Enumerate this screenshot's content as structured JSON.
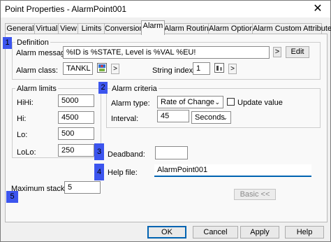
{
  "window": {
    "title": "Point Properties - AlarmPoint001",
    "close_glyph": "✕"
  },
  "tabs": [
    {
      "label": "General",
      "active": false
    },
    {
      "label": "Virtual",
      "active": false
    },
    {
      "label": "View",
      "active": false
    },
    {
      "label": "Limits",
      "active": false
    },
    {
      "label": "Conversion",
      "active": false
    },
    {
      "label": "Alarm",
      "active": true
    },
    {
      "label": "Alarm Routing",
      "active": false
    },
    {
      "label": "Alarm Options",
      "active": false
    },
    {
      "label": "Alarm Custom Attributes",
      "active": false
    }
  ],
  "definition": {
    "group_label": "Definition",
    "message_label": "Alarm message:",
    "message_value": "%ID is %STATE, Level is %VAL %EU!",
    "message_arrow": ">",
    "edit_label": "Edit",
    "class_label": "Alarm class:",
    "class_value": "TANKL",
    "class_arrow": ">",
    "string_index_label": "String index:",
    "string_index_value": "1",
    "string_index_arrow": ">"
  },
  "alarm_limits": {
    "group_label": "Alarm limits",
    "hihi_label": "HiHi:",
    "hihi_value": "5000",
    "hi_label": "Hi:",
    "hi_value": "4500",
    "lo_label": "Lo:",
    "lo_value": "500",
    "lolo_label": "LoLo:",
    "lolo_value": "250"
  },
  "alarm_criteria": {
    "group_label": "Alarm criteria",
    "type_label": "Alarm type:",
    "type_value": "Rate of Change",
    "update_value_label": "Update value",
    "update_value_checked": false,
    "interval_label": "Interval:",
    "interval_value": "45",
    "interval_unit": "Seconds"
  },
  "deadband": {
    "label": "Deadband:",
    "value": ""
  },
  "help_file": {
    "label": "Help file:",
    "value": "AlarmPoint001"
  },
  "maximum_stacked": {
    "label": "Maximum stacked:",
    "value": "5"
  },
  "basic_button_label": "Basic <<",
  "footer": {
    "ok_label": "OK",
    "cancel_label": "Cancel",
    "apply_label": "Apply",
    "help_label": "Help"
  },
  "annotations": {
    "b1": "1",
    "b2": "2",
    "b3": "3",
    "b4": "4",
    "b5": "5"
  },
  "colors": {
    "badge": "#3c55ee",
    "focus": "#0063b1"
  }
}
